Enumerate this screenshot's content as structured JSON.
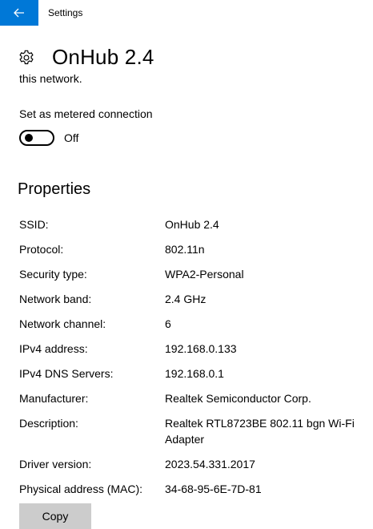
{
  "titlebar": {
    "app_title": "Settings",
    "back_icon": "arrow-left-icon",
    "accent": "#0078d7"
  },
  "header": {
    "icon": "gear-icon",
    "title": "OnHub 2.4"
  },
  "clipped_text": "this network.",
  "metered": {
    "label": "Set as metered connection",
    "state": "Off",
    "enabled": false
  },
  "properties": {
    "title": "Properties",
    "rows": [
      {
        "key": "SSID:",
        "value": "OnHub 2.4"
      },
      {
        "key": "Protocol:",
        "value": "802.11n"
      },
      {
        "key": "Security type:",
        "value": "WPA2-Personal"
      },
      {
        "key": "Network band:",
        "value": "2.4 GHz"
      },
      {
        "key": "Network channel:",
        "value": "6"
      },
      {
        "key": "IPv4 address:",
        "value": "192.168.0.133"
      },
      {
        "key": "IPv4 DNS Servers:",
        "value": "192.168.0.1"
      },
      {
        "key": "Manufacturer:",
        "value": "Realtek Semiconductor Corp."
      },
      {
        "key": "Description:",
        "value": "Realtek RTL8723BE 802.11 bgn Wi-Fi Adapter"
      },
      {
        "key": "Driver version:",
        "value": "2023.54.331.2017"
      },
      {
        "key": "Physical address (MAC):",
        "value": "34-68-95-6E-7D-81"
      }
    ],
    "copy_label": "Copy"
  }
}
